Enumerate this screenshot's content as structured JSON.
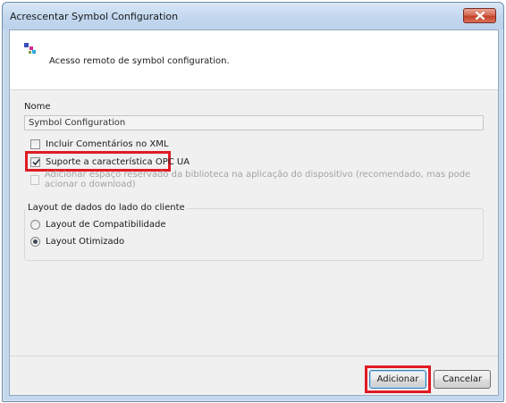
{
  "window": {
    "title": "Acrescentar Symbol Configuration"
  },
  "header": {
    "icon": "symbol-configuration-icon",
    "description": "Acesso remoto de symbol configuration."
  },
  "form": {
    "name_label": "Nome",
    "name_value": "Symbol Configuration",
    "checkboxes": [
      {
        "label": "Incluir Comentários no XML",
        "checked": false,
        "enabled": true
      },
      {
        "label": "Suporte a característica OPC UA",
        "checked": true,
        "enabled": true
      },
      {
        "label": "Adicionar espaço reservado da biblioteca na aplicação do dispositivo (recomendado, mas pode acionar o download)",
        "checked": false,
        "enabled": false
      }
    ],
    "layout_group": {
      "label": "Layout de dados do lado do cliente",
      "options": [
        {
          "label": "Layout de Compatibilidade",
          "selected": false
        },
        {
          "label": "Layout Otimizado",
          "selected": true
        }
      ]
    }
  },
  "buttons": {
    "add_label": "Adicionar",
    "cancel_label": "Cancelar"
  },
  "colors": {
    "highlight": "#e01b24",
    "title_bar": "#c2d7ee",
    "close_button": "#c3432b"
  }
}
